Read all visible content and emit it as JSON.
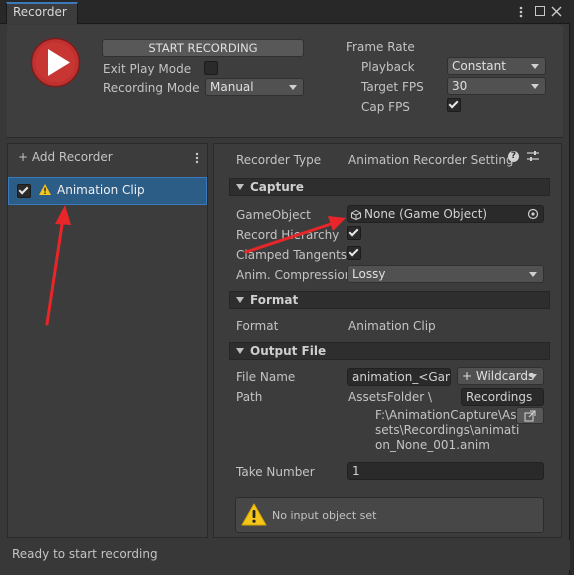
{
  "window": {
    "tab_label": "Recorder"
  },
  "top": {
    "start_recording_label": "START RECORDING",
    "exit_play_mode_label": "Exit Play Mode",
    "exit_play_mode_checked": false,
    "recording_mode_label": "Recording Mode",
    "recording_mode_value": "Manual",
    "frame_rate_label": "Frame Rate",
    "playback_label": "Playback",
    "playback_value": "Constant",
    "target_fps_label": "Target FPS",
    "target_fps_value": "30",
    "cap_fps_label": "Cap FPS",
    "cap_fps_checked": true
  },
  "list": {
    "add_recorder_label": "+ Add Recorder",
    "items": [
      {
        "label": "Animation Clip",
        "enabled": true,
        "warning": true
      }
    ]
  },
  "inspector": {
    "recorder_type_label": "Recorder Type",
    "recorder_type_value": "Animation Recorder Setting",
    "capture_title": "Capture",
    "gameobject_label": "GameObject",
    "gameobject_value": "None (Game Object)",
    "record_hierarchy_label": "Record Hierarchy",
    "record_hierarchy_checked": true,
    "clamped_tangents_label": "Clamped Tangents",
    "clamped_tangents_checked": true,
    "anim_compression_label": "Anim. Compression",
    "anim_compression_value": "Lossy",
    "format_title": "Format",
    "format_label": "Format",
    "format_value": "Animation Clip",
    "output_title": "Output File",
    "file_name_label": "File Name",
    "file_name_value": "animation_<Game",
    "wildcards_label": "+ Wildcards",
    "path_label": "Path",
    "path_root": "AssetsFolder \\",
    "path_folder": "Recordings",
    "full_path_line1": "F:\\AnimationCapture\\As",
    "full_path_line2": "sets\\Recordings\\animati",
    "full_path_line3": "on_None_001.anim",
    "take_number_label": "Take Number",
    "take_number_value": "1",
    "warning_message": "No input object set"
  },
  "status": {
    "text": "Ready to start recording"
  },
  "colors": {
    "accent": "#3a79bb",
    "record_red": "#c0302e",
    "warning_yellow": "#f4c51b",
    "annotation_red": "#e8262a"
  }
}
